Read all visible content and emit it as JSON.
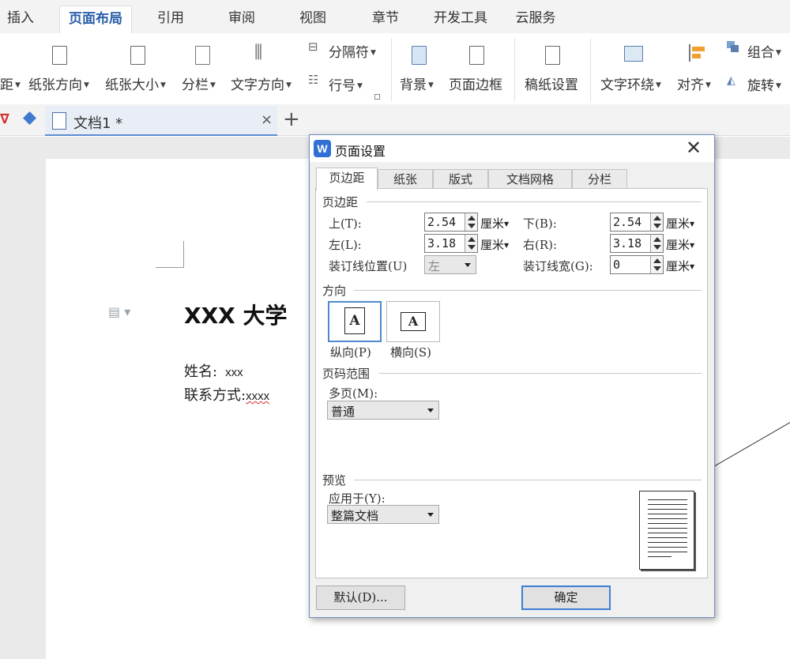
{
  "menu": {
    "tabs": [
      "插入",
      "页面布局",
      "引用",
      "审阅",
      "视图",
      "章节",
      "开发工具",
      "云服务"
    ],
    "active": "页面布局"
  },
  "ribbon": {
    "margins_partial": "距",
    "orientation": "纸张方向",
    "size": "纸张大小",
    "columns": "分栏",
    "text_direction": "文字方向",
    "separator": "分隔符",
    "line_number": "行号",
    "background": "背景",
    "page_border": "页面边框",
    "manuscript": "稿纸设置",
    "text_wrap": "文字环绕",
    "align": "对齐",
    "group": "组合",
    "rotate": "旋转"
  },
  "doc_tabs": {
    "current": "文档1 *",
    "close": "×",
    "new": "+"
  },
  "document": {
    "title": "XXX 大学",
    "name_label": "姓名:",
    "name_value": "xxx",
    "contact_label": "联系方式:",
    "contact_value": "xxxx"
  },
  "dialog": {
    "title": "页面设置",
    "tabs": [
      "页边距",
      "纸张",
      "版式",
      "文档网格",
      "分栏"
    ],
    "active_tab": "页边距",
    "margins": {
      "section": "页边距",
      "top_label": "上(T):",
      "top_value": "2.54",
      "bottom_label": "下(B):",
      "bottom_value": "2.54",
      "left_label": "左(L):",
      "left_value": "3.18",
      "right_label": "右(R):",
      "right_value": "3.18",
      "gutter_pos_label": "装订线位置(U)",
      "gutter_pos_value": "左",
      "gutter_width_label": "装订线宽(G):",
      "gutter_width_value": "0",
      "unit": "厘米"
    },
    "orientation": {
      "section": "方向",
      "portrait": "纵向(P)",
      "landscape": "横向(S)",
      "selected": "portrait",
      "glyph": "A"
    },
    "page_range": {
      "section": "页码范围",
      "multiple_label": "多页(M):",
      "multiple_value": "普通"
    },
    "preview": {
      "section": "预览",
      "apply_label": "应用于(Y):",
      "apply_value": "整篇文档"
    },
    "buttons": {
      "default": "默认(D)...",
      "ok": "确定"
    }
  }
}
